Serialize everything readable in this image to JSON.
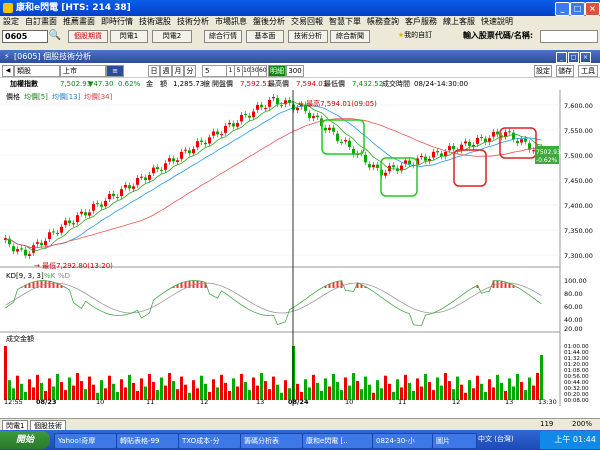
{
  "window": {
    "title": "康和e閃電 [HTS: 214 38]"
  },
  "menu": [
    "設定",
    "自訂畫面",
    "推薦畫面",
    "即時行情",
    "技術選股",
    "技術分析",
    "市場訊息",
    "盤後分析",
    "交易回報",
    "智慧下單",
    "帳務查詢",
    "客戶服務",
    "線上客服",
    "快速說明"
  ],
  "toolbar": {
    "code": "0605",
    "buttons": [
      "個股期貨",
      "閃電1",
      "閃電2",
      "綜合行情",
      "基本面",
      "技術分析",
      "綜合新聞"
    ],
    "favorite": "我的自訂",
    "search_label": "輸入股票代碼/名稱:"
  },
  "panel": {
    "title": "[0605] 個股技術分析",
    "buttons": [
      "設定",
      "儲存",
      "工具"
    ]
  },
  "options": {
    "type": "類股",
    "market": "上市",
    "periods": [
      "日",
      "週",
      "月",
      "分"
    ],
    "interval": "5",
    "minutes": [
      "1",
      "5",
      "10",
      "30",
      "60"
    ],
    "mode": "明細",
    "count": "300"
  },
  "index": {
    "name": "加權指數",
    "price": "7,502.93",
    "change": "▼47.30",
    "pct": "0.62%",
    "amount_label": "金",
    "amount_val": "額",
    "vol": "1,285.73",
    "unit": "億",
    "open_label": "開盤價",
    "open": "7,592.51",
    "high_label": "最高價",
    "high": "7,594.01",
    "low_label": "最低價",
    "low": "7,432.52",
    "time_label": "成交時間",
    "time": "08/24-14:30:00"
  },
  "legend": {
    "price": "價格",
    "ma5": "均價[5]",
    "ma13": "均價[13]",
    "ma34": "均價[34]",
    "kd": "KD[9, 3, 3]",
    "k": "%K",
    "d": "%D",
    "volume": "成交金額"
  },
  "annotations": {
    "high": "← 最高7,594.01(09:05)",
    "low": "→ 最低7,292.80(13:20)",
    "last_price": "7502.93",
    "last_pct": "-0.62%"
  },
  "yaxis_price": [
    "7,600.00",
    "7,550.00",
    "7,500.00",
    "7,450.00",
    "7,400.00",
    "7,350.00",
    "7,300.00"
  ],
  "yaxis_kd": [
    "100.00",
    "80.00",
    "60.00",
    "40.00",
    "20.00"
  ],
  "yaxis_vol": [
    "01:00.00",
    "01:44.00",
    "01:32.00",
    "01:20.00",
    "01:08.00",
    "00:56.00",
    "00:44.00",
    "00:32.00",
    "00:20.00",
    "00:08.00"
  ],
  "xaxis": [
    "12:55",
    "08/23",
    "10",
    "11",
    "12",
    "13",
    "08/24",
    "10",
    "11",
    "12",
    "13",
    "13:30"
  ],
  "status": {
    "tab1": "閃電1",
    "tab2": "個股技術",
    "page": "119",
    "zoom": "200%"
  },
  "taskbar": {
    "start": "開始",
    "tasks": [
      "Yahoo!奇摩",
      "轉貼表格-99",
      "TXO成本-分",
      "籌碼分析表",
      "康和e閃電 [..",
      "0824-30-小",
      "圖片"
    ],
    "ime": "中文 (台灣)",
    "clock": "上午 01:44"
  }
}
